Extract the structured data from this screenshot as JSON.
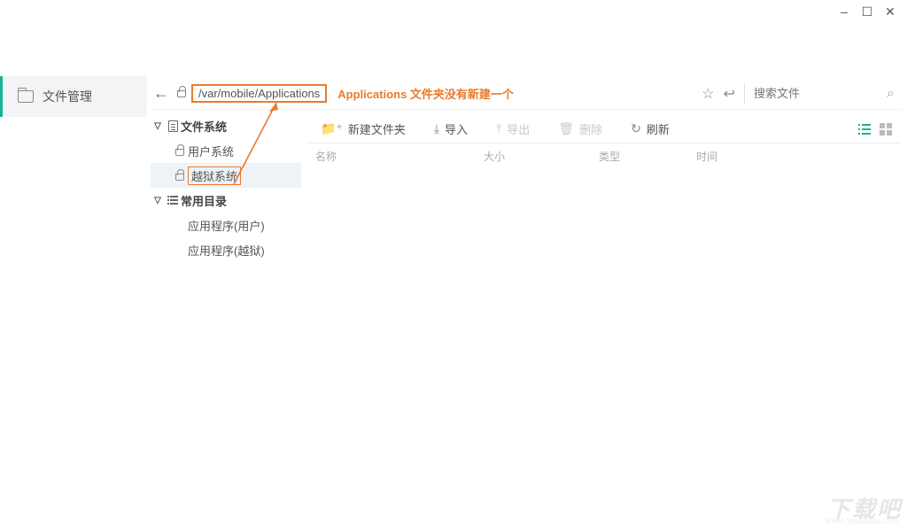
{
  "window": {
    "min": "–",
    "max": "☐",
    "close": "✕"
  },
  "nav": {
    "file_mgr": "文件管理"
  },
  "addr": {
    "path": "/var/mobile/Applications",
    "annotation": "Applications 文件夹没有新建一个",
    "star": "☆",
    "reload": "↩",
    "search_placeholder": "搜索文件",
    "search_glyph": "⌕"
  },
  "tree": {
    "fs_group": "文件系统",
    "user_sys": "用户系统",
    "jail_sys": "越狱系统",
    "common_group": "常用目录",
    "app_user": "应用程序(用户)",
    "app_jail": "应用程序(越狱)"
  },
  "toolbar": {
    "new_folder": "新建文件夹",
    "import": "导入",
    "export": "导出",
    "delete": "删除",
    "refresh": "刷新"
  },
  "columns": {
    "name": "名称",
    "size": "大小",
    "type": "类型",
    "time": "时间"
  },
  "watermark": {
    "main": "下载吧",
    "sub": "www.xiazaiba.com"
  }
}
